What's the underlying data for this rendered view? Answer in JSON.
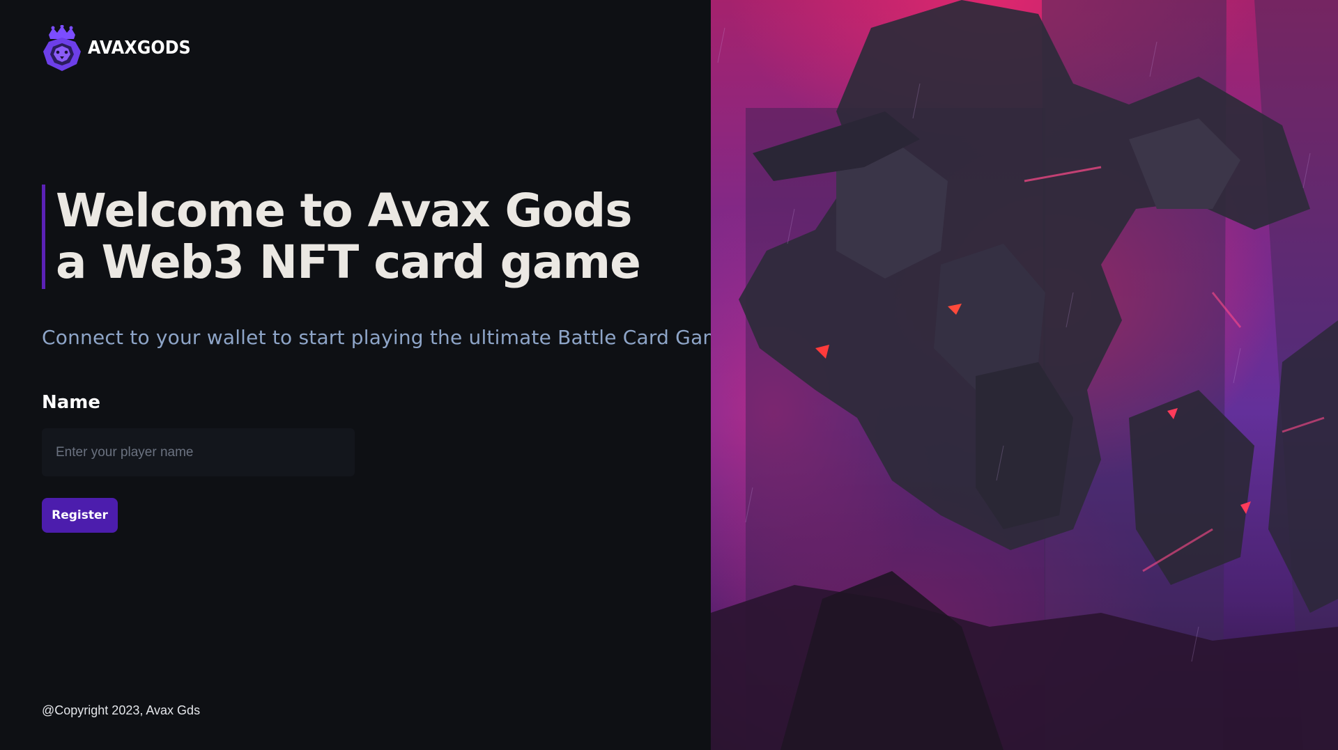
{
  "brand": {
    "logo_text": "AVAXGODS",
    "logo_icon": "crowned-lion-icon",
    "accent_color": "#5b21b6",
    "button_color": "#4c1dad"
  },
  "hero": {
    "title_line1": "Welcome to Avax Gods",
    "title_line2": "a Web3 NFT card game",
    "subtitle": "Connect to your wallet to start playing the ultimate Battle Card Game"
  },
  "form": {
    "name_label": "Name",
    "name_placeholder": "Enter your player name",
    "name_value": "",
    "register_label": "Register"
  },
  "footer": {
    "copyright": "@Copyright 2023, Avax Gds"
  },
  "artwork": {
    "description_icon": "mech-robot-artwork",
    "palette": [
      "#e0286e",
      "#7a2a8c",
      "#63309a",
      "#2b1538"
    ]
  }
}
